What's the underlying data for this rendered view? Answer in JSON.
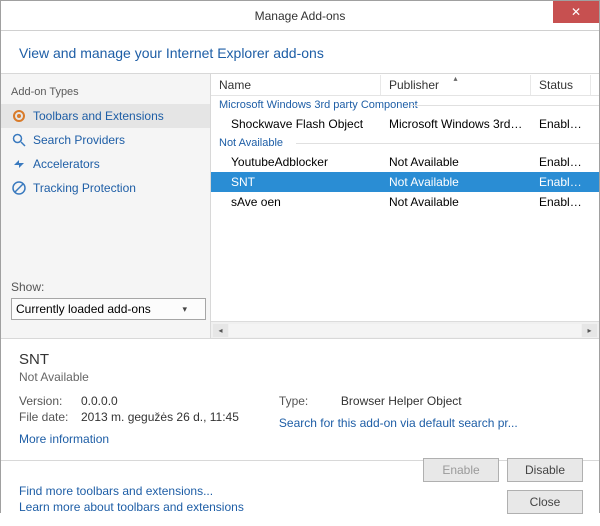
{
  "window": {
    "title": "Manage Add-ons",
    "header": "View and manage your Internet Explorer add-ons"
  },
  "sidebar": {
    "heading": "Add-on Types",
    "items": [
      {
        "label": "Toolbars and Extensions",
        "icon": "gear"
      },
      {
        "label": "Search Providers",
        "icon": "search"
      },
      {
        "label": "Accelerators",
        "icon": "accelerator"
      },
      {
        "label": "Tracking Protection",
        "icon": "track"
      }
    ],
    "show_label": "Show:",
    "show_value": "Currently loaded add-ons"
  },
  "columns": {
    "name": "Name",
    "publisher": "Publisher",
    "status": "Status"
  },
  "groups": [
    {
      "title": "Microsoft Windows 3rd party Component",
      "rows": [
        {
          "name": "Shockwave Flash Object",
          "publisher": "Microsoft Windows 3rd ...",
          "status": "Enabled",
          "selected": false
        }
      ]
    },
    {
      "title": "Not Available",
      "rows": [
        {
          "name": "YoutubeAdblocker",
          "publisher": "Not Available",
          "status": "Enabled",
          "selected": false
        },
        {
          "name": "SNT",
          "publisher": "Not Available",
          "status": "Enabled",
          "selected": true
        },
        {
          "name": "sAve oen",
          "publisher": "Not Available",
          "status": "Enabled",
          "selected": false
        }
      ]
    }
  ],
  "detail": {
    "name": "SNT",
    "publisher": "Not Available",
    "version_label": "Version:",
    "version": "0.0.0.0",
    "filedate_label": "File date:",
    "filedate": "2013 m. gegužės 26 d., 11:45",
    "more_info": "More information",
    "type_label": "Type:",
    "type": "Browser Helper Object",
    "search_link": "Search for this add-on via default search pr..."
  },
  "footer": {
    "link1": "Find more toolbars and extensions...",
    "link2": "Learn more about toolbars and extensions",
    "enable": "Enable",
    "disable": "Disable",
    "close": "Close"
  }
}
